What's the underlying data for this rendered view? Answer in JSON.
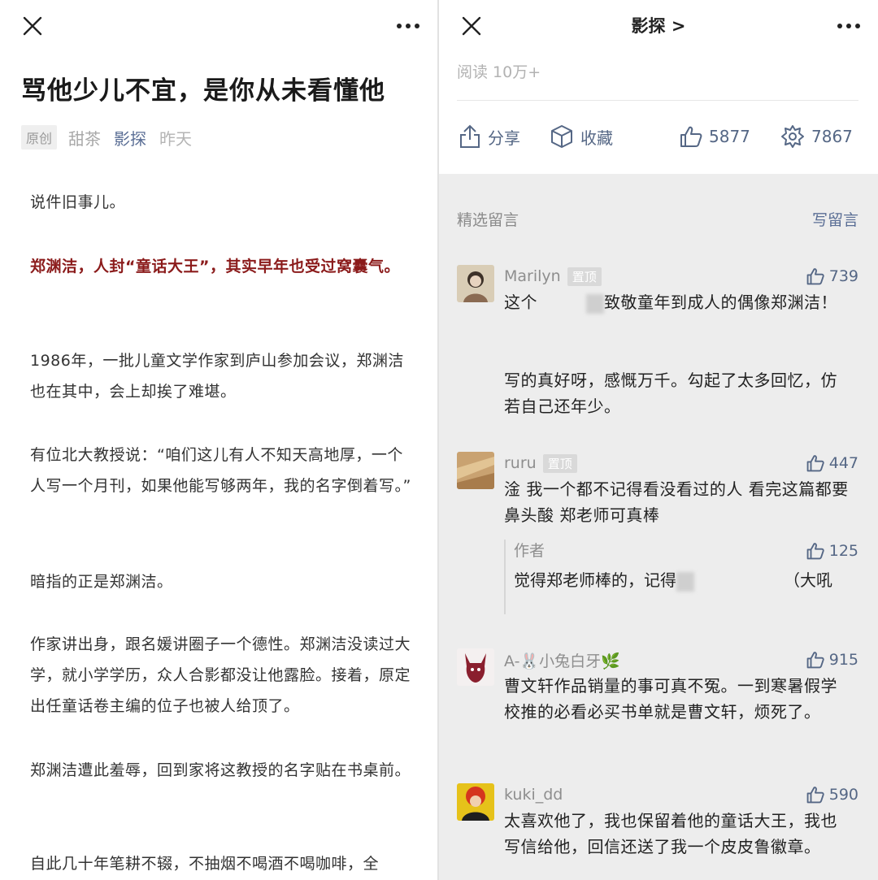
{
  "left": {
    "close_icon": "close-icon",
    "more_icon": "more-icon",
    "title": "骂他少儿不宜，是你从未看懂他",
    "badge": "原创",
    "author": "甜茶",
    "account": "影探",
    "date": "昨天",
    "paragraphs": [
      "说件旧事儿。",
      "郑渊洁，人封“童话大王”，其实早年也受过窝囊气。",
      "1986年，一批儿童文学作家到庐山参加会议，郑渊洁也在其中，会上却挨了难堪。",
      "有位北大教授说：“咱们这儿有人不知天高地厚，一个人写一个月刊，如果他能写够两年，我的名字倒着写。”",
      "暗指的正是郑渊洁。",
      "作家讲出身，跟名媛讲圈子一个德性。郑渊洁没读过大学，就小学学历，众人合影都没让他露脸。接着，原定出任童话卷主编的位子也被人给顶了。",
      "郑渊洁遭此羞辱，回到家将这教授的名字贴在书桌前。",
      "自此几十年笔耕不辍，不抽烟不喝酒不喝咖啡，全"
    ]
  },
  "right": {
    "header_title": "影探 >",
    "reads": "阅读 10万+",
    "share": "分享",
    "collect": "收藏",
    "likes": "5877",
    "wow": "7867",
    "comments_label": "精选留言",
    "write_comment": "写留言",
    "comments": [
      {
        "name": "Marilyn",
        "pinned": "置顶",
        "likes": "739",
        "text_a": "这个",
        "text_b": "致敬童年到成人的偶像郑渊洁！",
        "text_c": "写的真好呀，感慨万千。勾起了太多回忆，仿若自己还年少。"
      },
      {
        "name": "ruru",
        "pinned": "置顶",
        "likes": "447",
        "text": "淦 我一个都不记得看没看过的人 看完这篇都要鼻头酸 郑老师可真棒",
        "reply": {
          "name": "作者",
          "likes": "125",
          "text_a": "觉得郑老师棒的，记得",
          "text_b": "（大吼"
        }
      },
      {
        "name": "A-🐰小兔白牙🌿",
        "likes": "915",
        "text": "曹文轩作品销量的事可真不冤。一到寒暑假学校推的必看必买书单就是曹文轩，烦死了。"
      },
      {
        "name": "kuki_dd",
        "likes": "590",
        "text": "太喜欢他了，我也保留着他的童话大王，我也写信给他，回信还送了我一个皮皮鲁徽章。"
      }
    ]
  },
  "colors": {
    "accent": "#556785",
    "highlight_red": "#8b1b1b",
    "comment_bg": "#ededed"
  }
}
